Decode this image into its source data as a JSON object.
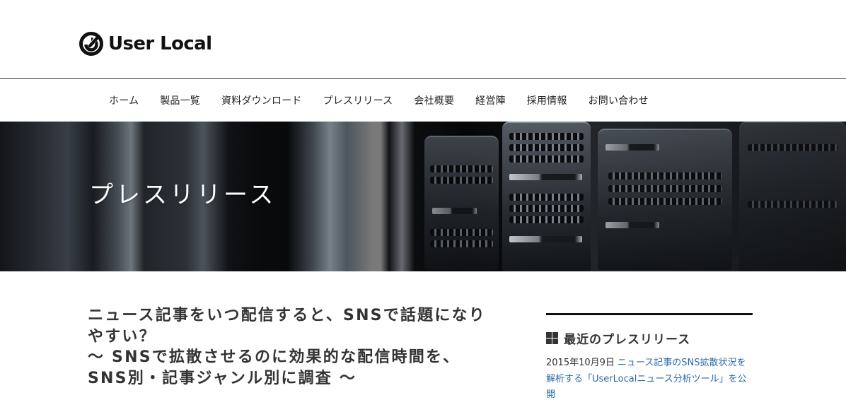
{
  "header": {
    "logo_text": "User Local",
    "logo_icon": "userlocal-logo-mark"
  },
  "nav": {
    "items": [
      {
        "label": "ホーム"
      },
      {
        "label": "製品一覧"
      },
      {
        "label": "資料ダウンロード"
      },
      {
        "label": "プレスリリース"
      },
      {
        "label": "会社概要"
      },
      {
        "label": "経営陣"
      },
      {
        "label": "採用情報"
      },
      {
        "label": "お問い合わせ"
      }
    ]
  },
  "hero": {
    "title": "プレスリリース",
    "image": "server-rack-photo"
  },
  "article": {
    "title_lines": [
      "ニュース記事をいつ配信すると、SNSで話題になり",
      "やすい？",
      "〜 SNSで拡散させるのに効果的な配信時間を、",
      "SNS別・記事ジャンル別に調査 〜"
    ]
  },
  "sidebar": {
    "widget_title": "最近のプレスリリース",
    "widget_icon": "grid-icon",
    "posts": [
      {
        "date": "2015年10月9日",
        "title": "ニュース記事のSNS拡散状況を解析する「UserLocalニュース分析ツール」を公開"
      }
    ]
  },
  "colors": {
    "text": "#333333",
    "link": "#2c6aa8",
    "hero_text": "#ffffff",
    "rule": "#111111"
  }
}
